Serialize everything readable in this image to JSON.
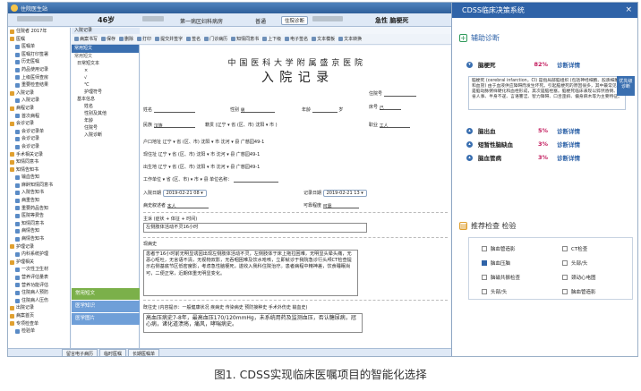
{
  "window": {
    "title": "住院医生站"
  },
  "patient": {
    "age": "46岁",
    "unit": "第一病区妇科病房",
    "type": "普通",
    "admit_btn": "住院诊断",
    "status": "急性 脑梗死"
  },
  "tree": {
    "items": [
      {
        "label": "住院者 2017年",
        "group": true
      },
      {
        "label": "医嘱",
        "group": true
      },
      {
        "label": "医嘱单",
        "group": false
      },
      {
        "label": "医嘱打印签署",
        "group": false
      },
      {
        "label": "历史医嘱",
        "group": false
      },
      {
        "label": "药品使用记录",
        "group": false
      },
      {
        "label": "上级医师查房",
        "group": false
      },
      {
        "label": "重要检查结果",
        "group": false
      },
      {
        "label": "入院记录",
        "group": true
      },
      {
        "label": "入院记录",
        "group": false
      },
      {
        "label": "病程记录",
        "group": true
      },
      {
        "label": "首次病程",
        "group": false
      },
      {
        "label": "会诊记录",
        "group": true
      },
      {
        "label": "会诊记录单",
        "group": false
      },
      {
        "label": "会诊记录",
        "group": false
      },
      {
        "label": "会诊记录",
        "group": false
      },
      {
        "label": "手术相关记录",
        "group": true
      },
      {
        "label": "知情同意书",
        "group": true
      },
      {
        "label": "知情告知书",
        "group": true
      },
      {
        "label": "输血告知",
        "group": false
      },
      {
        "label": "麻醉知情同意书",
        "group": false
      },
      {
        "label": "入院告知书",
        "group": false
      },
      {
        "label": "病重告知",
        "group": false
      },
      {
        "label": "重要药品告知",
        "group": false
      },
      {
        "label": "医院等费告",
        "group": false
      },
      {
        "label": "知情同意书",
        "group": false
      },
      {
        "label": "病情告知",
        "group": false
      },
      {
        "label": "病情告知书",
        "group": false
      },
      {
        "label": "护理记录",
        "group": true
      },
      {
        "label": "内科系统护理",
        "group": false
      },
      {
        "label": "护理相关",
        "group": true
      },
      {
        "label": "一次性卫生材",
        "group": false
      },
      {
        "label": "营养评估量表",
        "group": false
      },
      {
        "label": "营养功能评估",
        "group": false
      },
      {
        "label": "住院病人预防",
        "group": false
      },
      {
        "label": "住院病人压伤",
        "group": false
      },
      {
        "label": "出院记录",
        "group": true
      },
      {
        "label": "病案首页",
        "group": true
      },
      {
        "label": "专项检查单",
        "group": true
      },
      {
        "label": "检验单",
        "group": false
      }
    ]
  },
  "template_panel": {
    "header": "常用短文",
    "subheader": "常用短文",
    "items": [
      "日常短文本",
      "×",
      "√",
      "℃",
      "护理符号",
      "基本信息",
      "姓名",
      "性别及其他",
      "年龄",
      "住院号",
      "入院诊断"
    ],
    "tab_common": "常用短文",
    "tab_a": "医学知识",
    "tab_b": "医学图片"
  },
  "editor": {
    "tab": "入院记录"
  },
  "toolbar": [
    "病案书写",
    "保存",
    "删除",
    "打印",
    "提交并签字",
    "签名",
    "门诊病历",
    "知情同意书",
    "上下级",
    "电子签名",
    "文本模板",
    "文本转换"
  ],
  "document": {
    "hospital": "中 国 医 科 大 学 附 属 盛 京 医 院",
    "title": "入 院 记 录",
    "labels": {
      "name": "姓名",
      "gender": "性别",
      "gender_val": "男",
      "age": "年龄",
      "age_unit": "岁",
      "ward_no": "住院号",
      "bed": "床号",
      "bed_val": "己",
      "ethnicity": "民族",
      "ethnicity_val": "汉族",
      "native": "籍贯",
      "native_val": "(辽宁 ▾ 省 (区、市)  沈阳 ▾ 市  )",
      "occupation": "职业",
      "occupation_val": "工人",
      "address": "户口地址",
      "address_val": "辽宁 ▾ 省 (区、市)  沈阳 ▾ 市  沈河 ▾ 县  广慈园49-1",
      "current": "现住址",
      "current_val": "辽宁 ▾ 省 (区、市)  沈阳 ▾ 市  沈河 ▾ 县  广慈园49-1",
      "birthplace": "出生地",
      "birthplace_val": "辽宁 ▾ 省 (区、市)  沈阳 ▾ 市  沈河 ▾ 县  广慈园49-1",
      "work": "工作单位",
      "work_val": "▾ 省 (区、市)  ▾ 市  ▾ 县  单位名称：",
      "admit_date": "入院日期",
      "admit_date_val": "2019-02-21 08 ▾",
      "record_date": "记录日期",
      "record_date_val": "2019-02-21 13 ▾",
      "narrator": "病史叙述者",
      "narrator_val": "本人",
      "reliability": "可靠程度",
      "reliability_val": "可靠",
      "chief_complaint": "主诉 (症状 + 体征 + 时间)",
      "chief_val": "左侧肢体活动不灵16小时",
      "hpi": "现病史",
      "hpi_text": "患者于16小时前无明显诱因出现左侧肢体活动不灵，左侧肢体于床上拖拉困难，无明显头晕头痛，无恶心呕吐，无言语不清，无视物双影，无吞咽困难及饮水呛咳，立即就诊于我院急诊行头颅CT检查提示右侧基底节区低密度影，考虑急性脑梗死，遂收入我科住院治疗。患者病程中精神差，饮食睡眠尚可，二便正常，近期体重无明显变化。",
      "past": "既往史 (内容提示：一般健康状况 疾病史 传染病史 预防接种史 手术外伤史 输血史)",
      "past_text": "高血压病史7-8年，最高血压170/120mmHg，未系统用药及监测血压，否认糖尿病，冠心病，诸化道溃疡，痛风，哮喘病史。"
    }
  },
  "statusbar": [
    "留言电子病历",
    "临时医嘱",
    "长期医嘱单"
  ],
  "cdss": {
    "title": "CDSS临床决策系统",
    "close": "×",
    "aux_dx": "辅助诊断",
    "aux_icon": "+",
    "diagnoses": [
      {
        "name": "脑梗死",
        "pct": "82%",
        "detail": "诊断详情",
        "chev": "▾"
      },
      {
        "name": "脑出血",
        "pct": "5%",
        "detail": "诊断详情",
        "chev": "▴"
      },
      {
        "name": "短暂性脑缺血",
        "pct": "3%",
        "detail": "诊断详情",
        "chev": "▴"
      },
      {
        "name": "脑血管病",
        "pct": "3%",
        "detail": "诊断详情",
        "chev": "▴"
      }
    ],
    "dx_desc": "脑梗死 (cerebral infarction，CI) 是指局部脑组织 (包括神经细胞、胶质细胞和血管) 由于血液供应障碍而发生坏死。引起脑梗死的原因很多，其中最常见的是脑动脉粥样硬化和血栓形成，其次是脑栓塞。脑梗死临床表现以猝然昏倒、不省人事、半身不遂、言语謇涩、智力障碍、口舌歪斜、偏身麻木等为主要特征。",
    "dx_tag": "优先级 诊断",
    "exam_title": "推荐检查 检验",
    "exams": [
      {
        "label": "脑血管造影",
        "checked": false
      },
      {
        "label": "CT检查",
        "checked": false
      },
      {
        "label": "脑血压脑",
        "checked": true
      },
      {
        "label": "头部/头",
        "checked": false
      },
      {
        "label": "脑磁共振检查",
        "checked": false
      },
      {
        "label": "颈动心电图",
        "checked": false
      },
      {
        "label": "头部/头",
        "checked": false
      },
      {
        "label": "脑血管造影",
        "checked": false
      }
    ],
    "colors": {
      "header": "#2f63a8",
      "pct": "#c2185b"
    }
  },
  "caption": "图1. CDSS实现临床医嘱项目的智能化选择"
}
